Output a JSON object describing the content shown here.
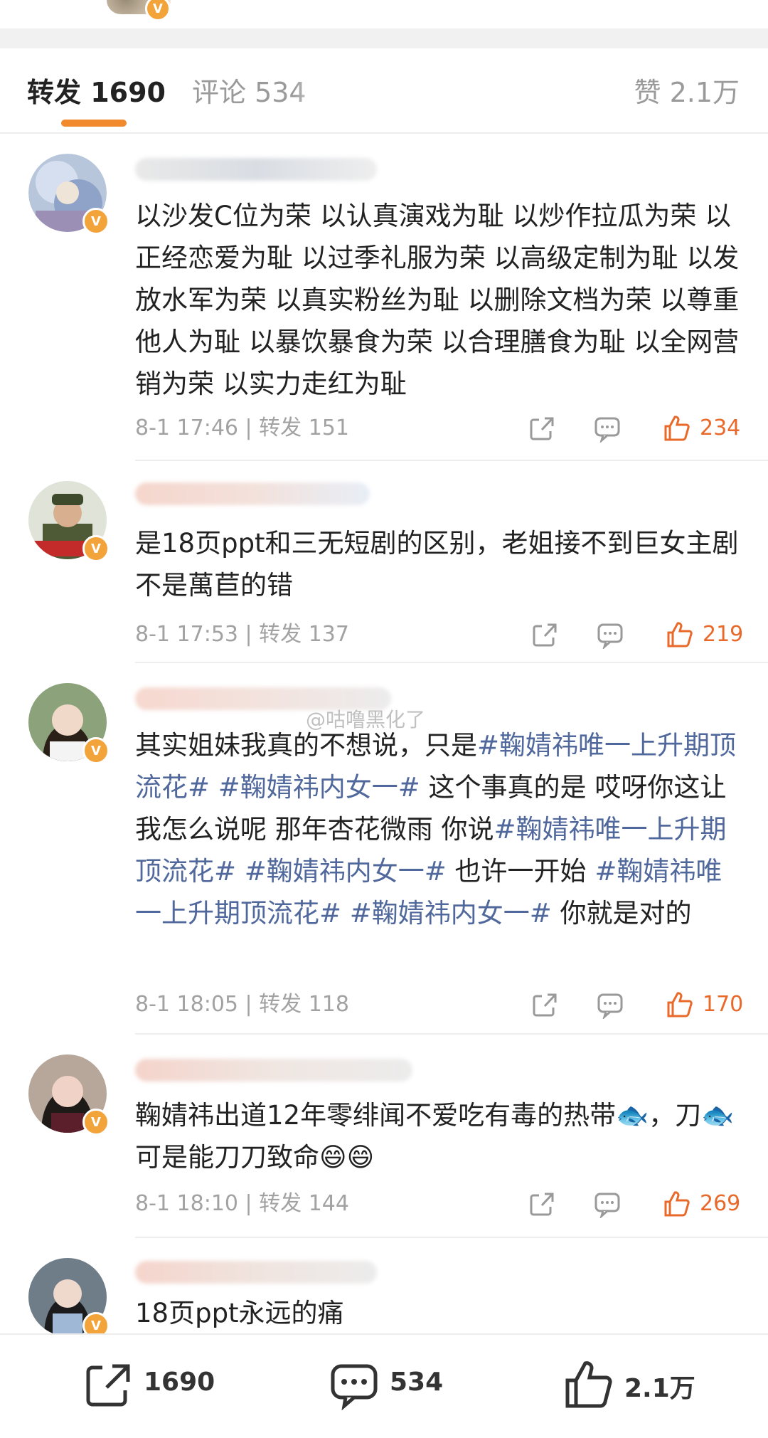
{
  "tabs": {
    "repost": "转发 1690",
    "comment": "评论 534",
    "like": "赞 2.1万"
  },
  "watermark": "@咕噜黑化了",
  "comments": [
    {
      "content": "以沙发C位为荣 以认真演戏为耻 以炒作拉瓜为荣 以正经恋爱为耻 以过季礼服为荣 以高级定制为耻 以发放水军为荣 以真实粉丝为耻 以删除文档为荣 以尊重他人为耻 以暴饮暴食为荣 以合理膳食为耻 以全网营销为荣 以实力走红为耻",
      "meta": "8-1 17:46 | 转发 151",
      "likes": "234"
    },
    {
      "content": "是18页ppt和三无短剧的区别，老姐接不到巨女主剧不是萬苣的错",
      "meta": "8-1 17:53 | 转发 137",
      "likes": "219"
    },
    {
      "content_parts": [
        "其实姐妹我真的不想说，只是",
        "#鞠婧祎唯一上升期顶流花#",
        " ",
        "#鞠婧祎内女一#",
        " 这个事真的是 哎呀你这让我怎么说呢 那年杏花微雨 你说",
        "#鞠婧祎唯一上升期顶流花#",
        " ",
        "#鞠婧祎内女一#",
        " 也许一开始 ",
        "#鞠婧祎唯一上升期顶流花#",
        " ",
        "#鞠婧祎内女一#",
        " 你就是对的"
      ],
      "meta": "8-1 18:05 | 转发 118",
      "likes": "170"
    },
    {
      "content": "鞠婧祎出道12年零绯闻不爱吃有毒的热带🐟，刀🐟可是能刀刀致命😄😄",
      "meta": "8-1 18:10 | 转发 144",
      "likes": "269"
    },
    {
      "content": "18页ppt永远的痛"
    }
  ],
  "bottombar": {
    "repost": "1690",
    "comment": "534",
    "like": "2.1万"
  },
  "colors": {
    "accent": "#f08a2d",
    "like": "#e8692a",
    "hashtag": "#50689c",
    "verified": "#f2a33a"
  },
  "icons": [
    "share-icon",
    "comment-icon",
    "like-icon",
    "verified-icon"
  ]
}
